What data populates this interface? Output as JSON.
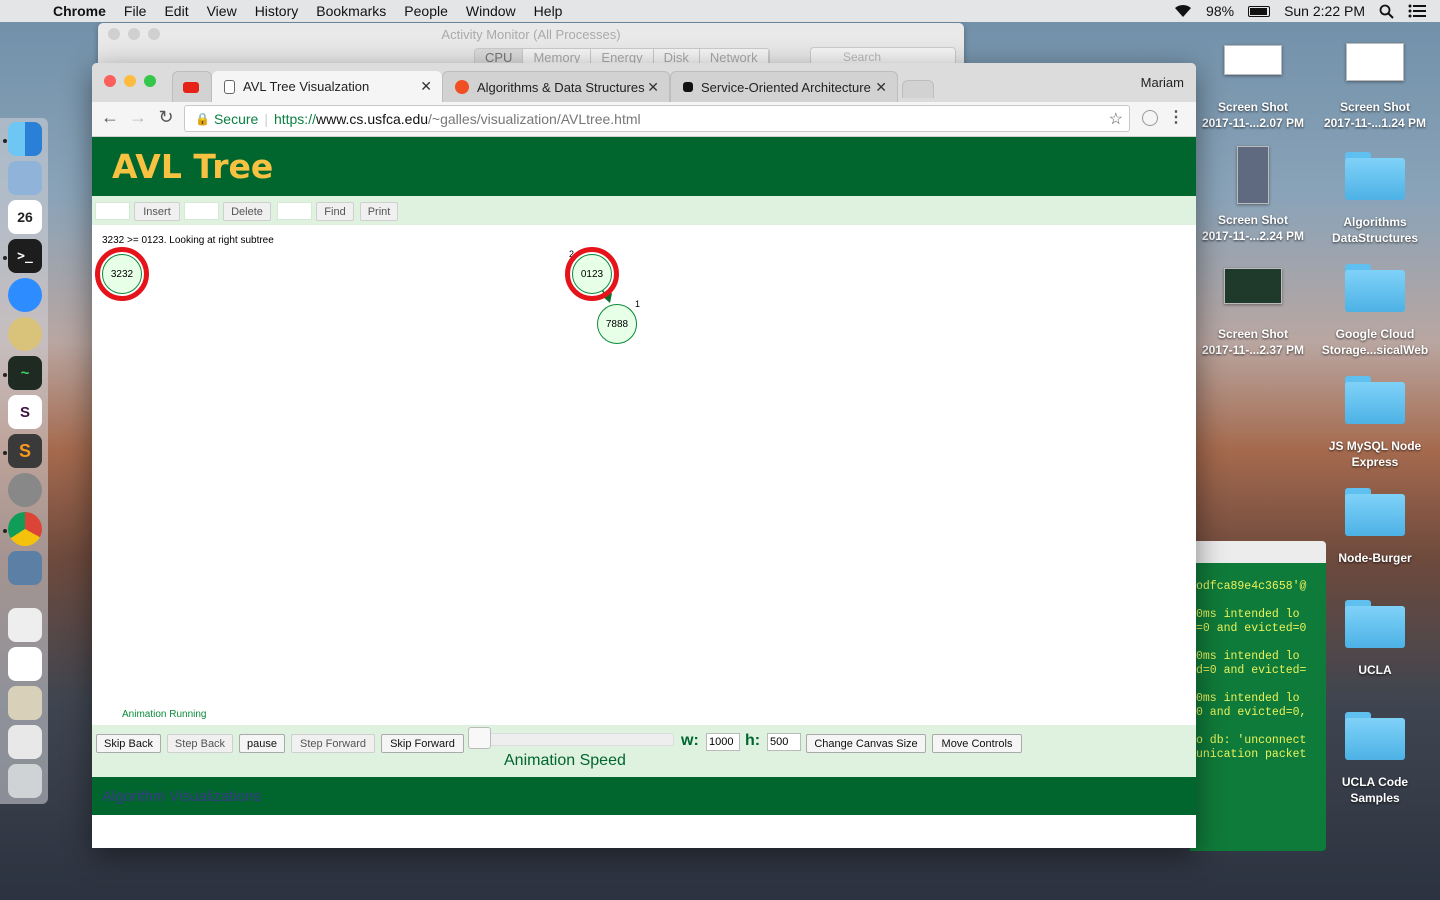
{
  "menubar": {
    "app": "Chrome",
    "items": [
      "File",
      "Edit",
      "View",
      "History",
      "Bookmarks",
      "People",
      "Window",
      "Help"
    ],
    "battery": "98%",
    "clock": "Sun 2:22 PM"
  },
  "activity_monitor": {
    "title": "Activity Monitor (All Processes)",
    "tabs": [
      "CPU",
      "Memory",
      "Energy",
      "Disk",
      "Network"
    ],
    "search_placeholder": "Search"
  },
  "desktop": {
    "items": [
      {
        "line1": "Screen Shot",
        "line2": "2017-11-...2.07 PM"
      },
      {
        "line1": "Screen Shot",
        "line2": "2017-11-...1.24 PM"
      },
      {
        "line1": "Screen Shot",
        "line2": "2017-11-...2.24 PM"
      },
      {
        "line1": "Algorithms",
        "line2": "DataStructures"
      },
      {
        "line1": "Screen Shot",
        "line2": "2017-11-...2.37 PM"
      },
      {
        "line1": "Google Cloud",
        "line2": "Storage...sicalWeb"
      },
      {
        "line1": "JS MySQL Node",
        "line2": "Express"
      },
      {
        "line1": "Node-Burger",
        "line2": ""
      },
      {
        "line1": "UCLA",
        "line2": ""
      },
      {
        "line1": "UCLA Code",
        "line2": "Samples"
      }
    ]
  },
  "terminal": {
    "lines": [
      "odfca89e4c3658'@",
      "",
      "0ms intended lo",
      "=0 and evicted=0",
      "",
      "0ms intended lo",
      "d=0 and evicted=",
      "",
      "0ms intended lo",
      "0 and evicted=0,",
      "",
      "o db: 'unconnect",
      "unication packet"
    ]
  },
  "browser": {
    "tabs": [
      {
        "title": "AVL Tree Visualzation"
      },
      {
        "title": "Algorithms & Data Structures"
      },
      {
        "title": "Service-Oriented Architecture"
      }
    ],
    "profile": "Mariam",
    "secure_label": "Secure",
    "url_scheme": "https://",
    "url_host": "www.cs.usfca.edu",
    "url_path": "/~galles/visualization/AVLtree.html"
  },
  "page": {
    "title": "AVL Tree",
    "controls": {
      "insert": "Insert",
      "delete": "Delete",
      "find": "Find",
      "print": "Print"
    },
    "status_message": "3232 >= 0123.  Looking at right subtree",
    "nodes": [
      {
        "value": "3232"
      },
      {
        "value": "0123",
        "height": "2"
      },
      {
        "value": "7888",
        "height": "1"
      }
    ],
    "animation_status": "Animation Running",
    "anim_controls": {
      "skip_back": "Skip Back",
      "step_back": "Step Back",
      "pause": "pause",
      "step_forward": "Step Forward",
      "skip_forward": "Skip Forward",
      "speed_label": "Animation Speed",
      "w_label": "w:",
      "w_value": "1000",
      "h_label": "h:",
      "h_value": "500",
      "change_canvas": "Change Canvas Size",
      "move_controls": "Move Controls"
    },
    "footer_link": "Algorithm Visualizations"
  },
  "colors": {
    "header_green": "#00662e",
    "title_gold": "#f7c241",
    "control_bg": "#dff1df",
    "highlight_ring": "#e5141b",
    "node_fill": "#e7ffe7"
  }
}
